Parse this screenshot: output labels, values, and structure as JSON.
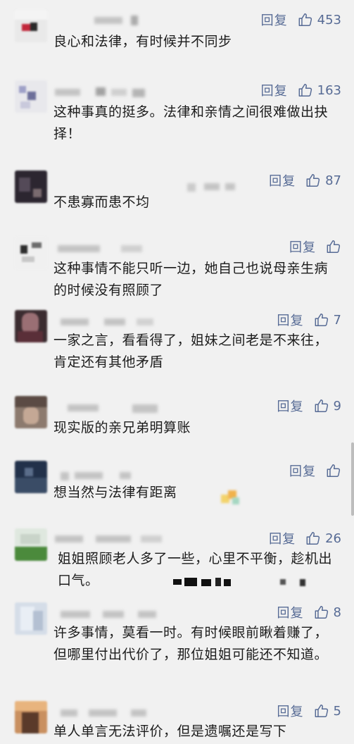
{
  "reply_label": "回复",
  "colors": {
    "link": "#576b95",
    "text": "#1c1c1c",
    "background": "#f1f1f1"
  },
  "icons": {
    "like": "thumbs-up-icon"
  },
  "comments": [
    {
      "text": "良心和法律，有时候并不同步",
      "likes": "453"
    },
    {
      "text": "这种事真的挺多。法律和亲情之间很难做出抉择！",
      "likes": "163"
    },
    {
      "text": "不患寡而患不均",
      "likes": "87"
    },
    {
      "text": "这种事情不能只听一边，她自己也说母亲生病的时候没有照顾了",
      "likes": ""
    },
    {
      "text": "一家之言，看看得了，姐妹之间老是不来往，肯定还有其他矛盾",
      "likes": "7"
    },
    {
      "text": "现实版的亲兄弟明算账",
      "likes": "9"
    },
    {
      "text": "想当然与法律有距离",
      "likes": ""
    },
    {
      "text": "姐姐照顾老人多了一些，心里不平衡，趁机出口气。",
      "likes": "26"
    },
    {
      "text": "许多事情，莫看一时。有时候眼前瞅着赚了，但哪里付出代价了，那位姐姐可能还不知道。",
      "likes": "8"
    },
    {
      "text": "单人单言无法评价，但是遗嘱还是写下",
      "likes": "5"
    }
  ]
}
